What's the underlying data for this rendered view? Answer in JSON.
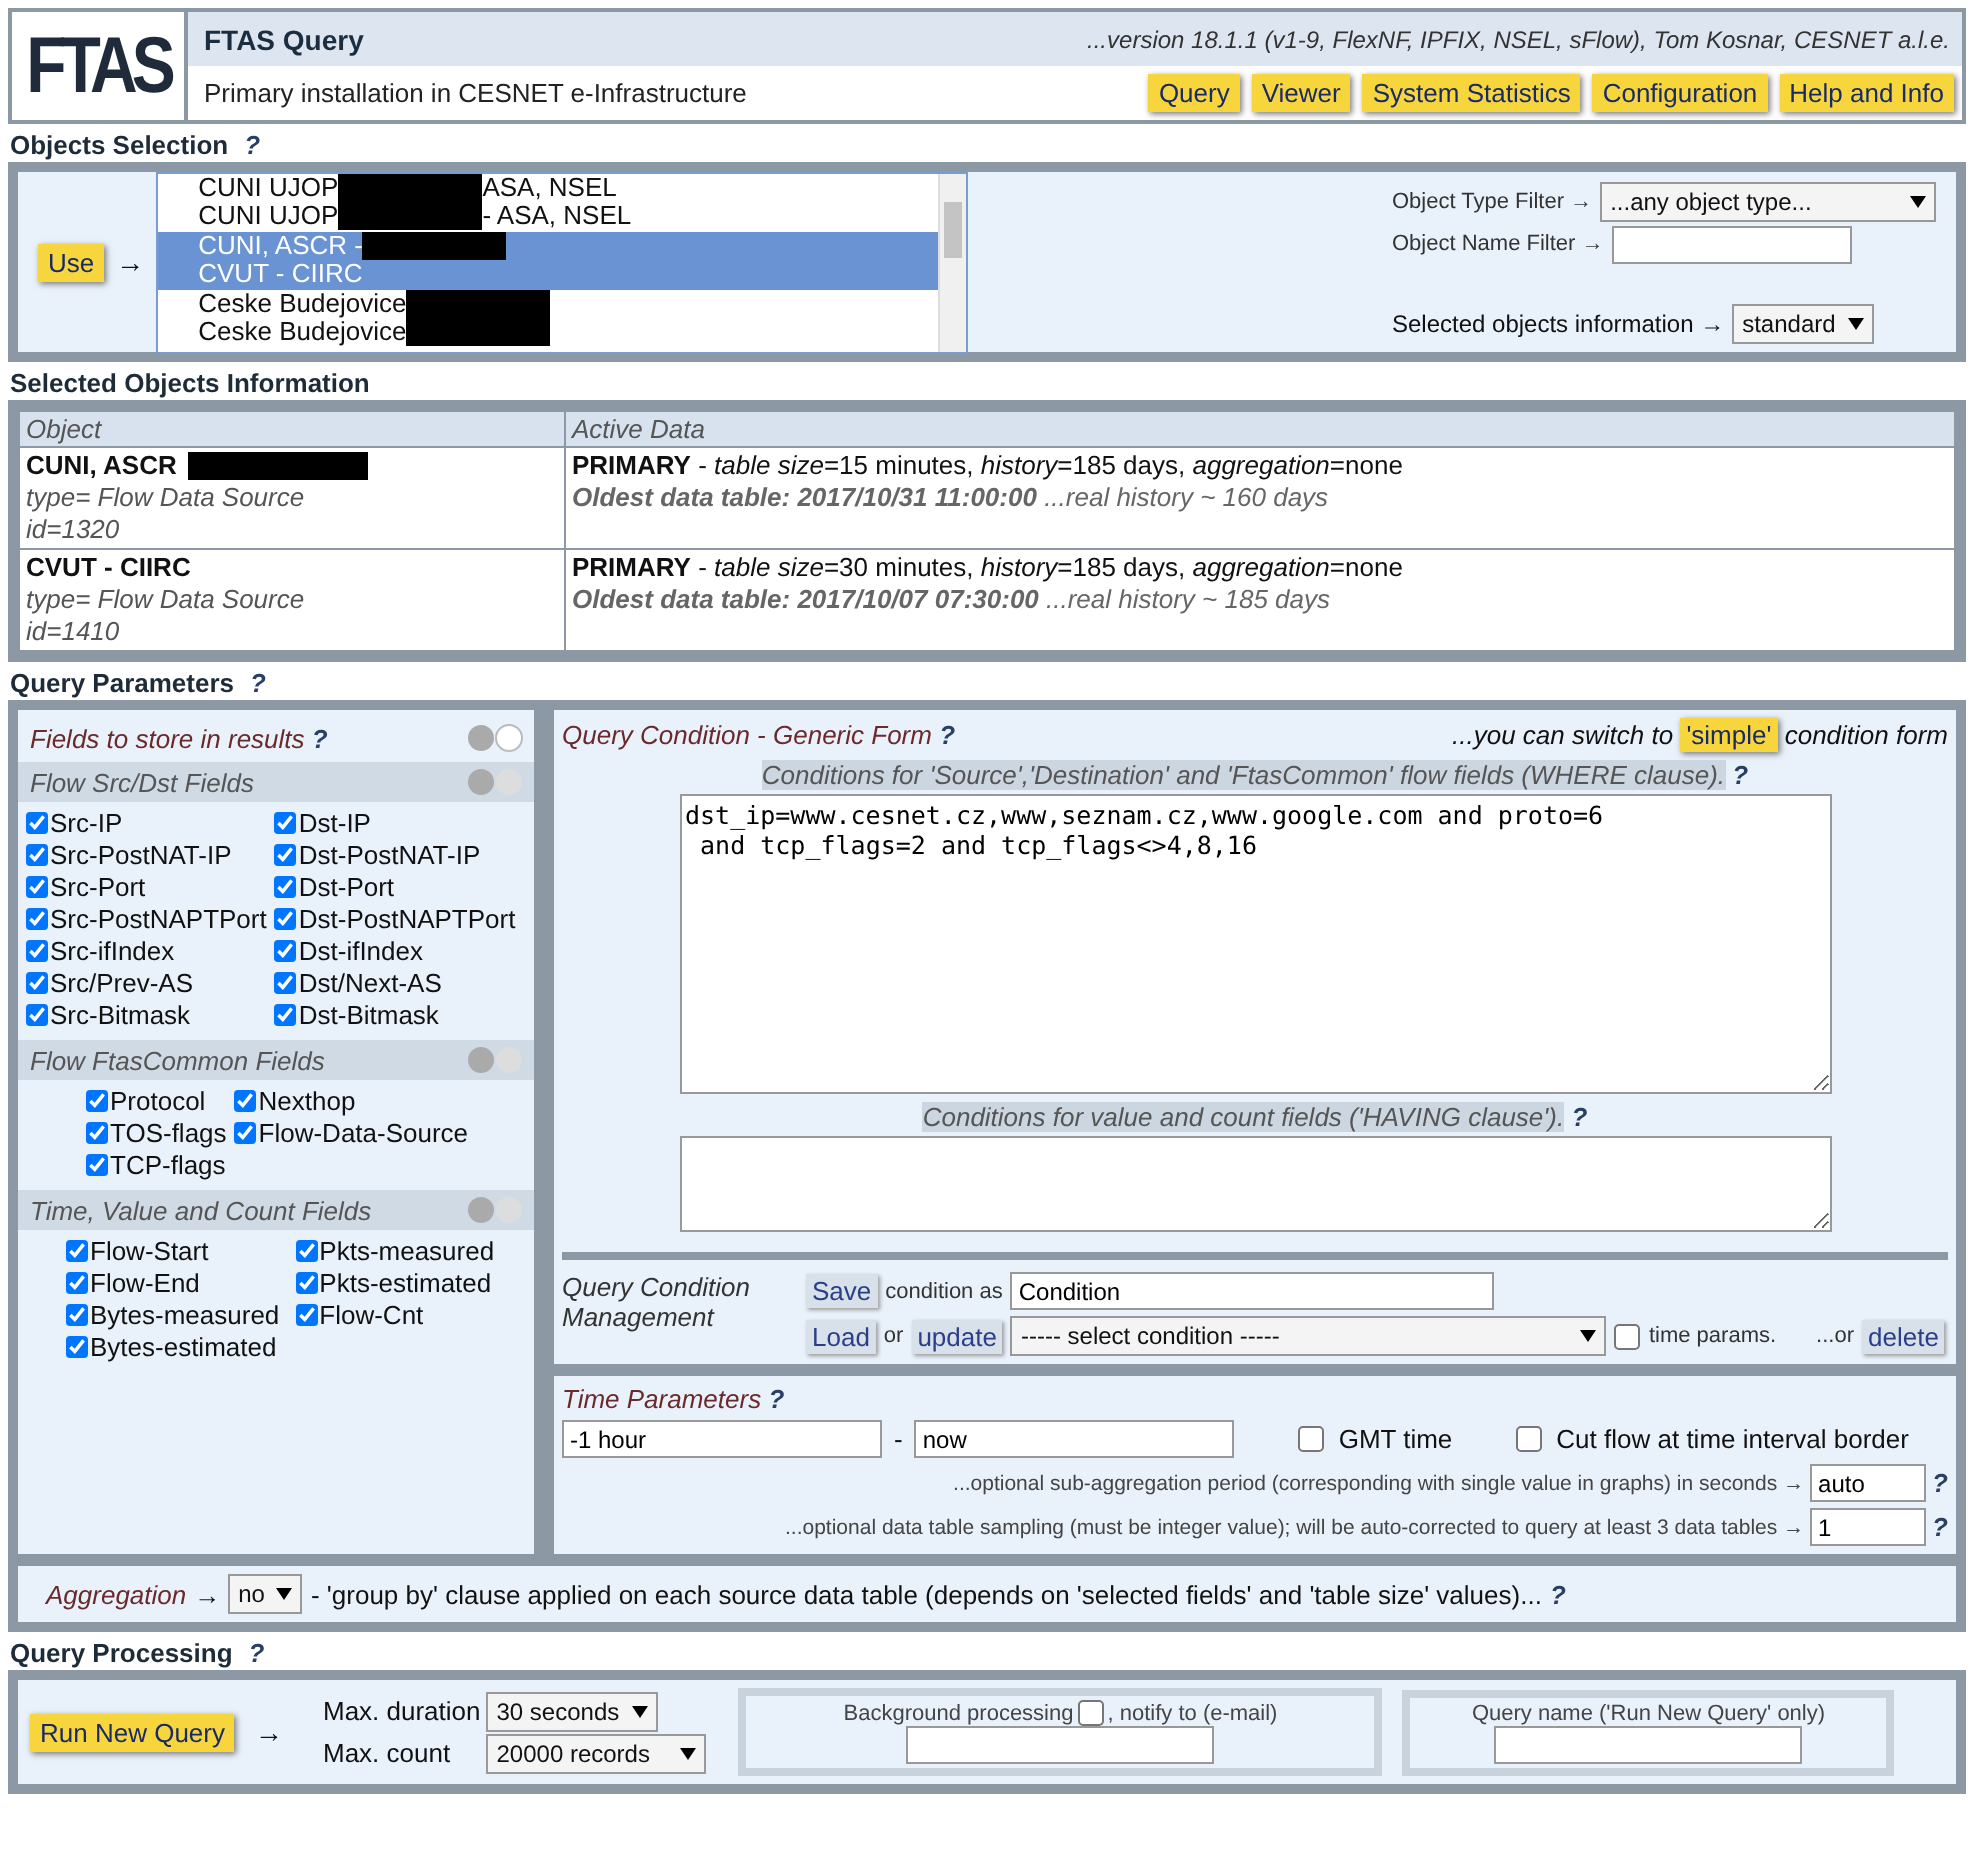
{
  "header": {
    "logo": "FTAS",
    "title": "FTAS Query",
    "version": "...version 18.1.1 (v1-9, FlexNF, IPFIX, NSEL, sFlow), Tom Kosnar, CESNET a.l.e.",
    "subtitle": "Primary installation in CESNET e-Infrastructure",
    "nav": [
      "Query",
      "Viewer",
      "System Statistics",
      "Configuration",
      "Help and Info"
    ]
  },
  "objects_selection": {
    "heading": "Objects Selection",
    "help": "?",
    "use_button": "Use",
    "arrow": "→",
    "list": [
      {
        "text": "CUNI UJOP",
        "redacted": true,
        "after": "ASA, NSEL",
        "selected": false
      },
      {
        "text": "CUNI UJOP",
        "redacted": true,
        "after": "- ASA, NSEL",
        "selected": false
      },
      {
        "text": "CUNI, ASCR -",
        "redacted": true,
        "selected": true
      },
      {
        "text": "CVUT - CIIRC",
        "redacted": false,
        "selected": true
      },
      {
        "text": "Ceske Budejovice",
        "redacted": true,
        "selected": false
      },
      {
        "text": "Ceske Budejovice",
        "redacted": true,
        "selected": false
      }
    ],
    "type_filter_label": "Object Type Filter →",
    "type_filter_value": "...any object type...",
    "name_filter_label": "Object Name Filter →",
    "info_label": "Selected objects information →",
    "info_value": "standard"
  },
  "selected_objects": {
    "heading": "Selected Objects Information",
    "columns": [
      "Object",
      "Active Data"
    ],
    "rows": [
      {
        "name": "CUNI, ASCR",
        "redacted": true,
        "type": "type= Flow Data Source",
        "id": "id=1320",
        "active": "**PRIMARY** -  *table size*=15 minutes, *history*=185 days, *aggregation*=none",
        "oldest": "**Oldest data table: 2017/10/31 11:00:00** ...real history ~ 160 days"
      },
      {
        "name": "CVUT - CIIRC",
        "redacted": false,
        "type": "type= Flow Data Source",
        "id": "id=1410",
        "active": "**PRIMARY** -  *table size*=30 minutes, *history*=185 days, *aggregation*=none",
        "oldest": "**Oldest data table: 2017/10/07 07:30:00** ...real history ~ 185 days"
      }
    ]
  },
  "query_parameters": {
    "heading": "Query Parameters",
    "help": "?",
    "fields": {
      "title": "Fields to store in results",
      "help": "?",
      "groups": [
        {
          "title": "Flow Src/Dst Fields",
          "fields": [
            {
              "label": "Src-IP",
              "checked": true
            },
            {
              "label": "Dst-IP",
              "checked": true
            },
            {
              "label": "Src-PostNAT-IP",
              "checked": true
            },
            {
              "label": "Dst-PostNAT-IP",
              "checked": true
            },
            {
              "label": "Src-Port",
              "checked": true
            },
            {
              "label": "Dst-Port",
              "checked": true
            },
            {
              "label": "Src-PostNAPTPort",
              "checked": true
            },
            {
              "label": "Dst-PostNAPTPort",
              "checked": true
            },
            {
              "label": "Src-ifIndex",
              "checked": true
            },
            {
              "label": "Dst-ifIndex",
              "checked": true
            },
            {
              "label": "Src/Prev-AS",
              "checked": true
            },
            {
              "label": "Dst/Next-AS",
              "checked": true
            },
            {
              "label": "Src-Bitmask",
              "checked": true
            },
            {
              "label": "Dst-Bitmask",
              "checked": true
            }
          ]
        },
        {
          "title": "Flow FtasCommon Fields",
          "fields": [
            {
              "label": "Protocol",
              "checked": true
            },
            {
              "label": "Nexthop",
              "checked": true
            },
            {
              "label": "TOS-flags",
              "checked": true
            },
            {
              "label": "Flow-Data-Source",
              "checked": true
            },
            {
              "label": "TCP-flags",
              "checked": true
            }
          ]
        },
        {
          "title": "Time, Value and Count Fields",
          "fields": [
            {
              "label": "Flow-Start",
              "checked": true
            },
            {
              "label": "Pkts-measured",
              "checked": true
            },
            {
              "label": "Flow-End",
              "checked": true
            },
            {
              "label": "Pkts-estimated",
              "checked": true
            },
            {
              "label": "Bytes-measured",
              "checked": true
            },
            {
              "label": "Flow-Cnt",
              "checked": true
            },
            {
              "label": "Bytes-estimated",
              "checked": true
            }
          ]
        }
      ]
    },
    "condition": {
      "title": "Query Condition - Generic Form",
      "help": "?",
      "switch_text": "...you can switch to",
      "simple_button": "'simple'",
      "switch_after": "condition form",
      "where_label": "Conditions for 'Source','Destination' and 'FtasCommon' flow fields (WHERE clause).",
      "where_help": "?",
      "where_value": "dst_ip=www.cesnet.cz,www,seznam.cz,www.google.com and proto=6\n and tcp_flags=2 and tcp_flags<>4,8,16",
      "having_label": "Conditions for value and count fields ('HAVING clause').",
      "having_help": "?"
    },
    "management": {
      "label": "Query Condition Management",
      "save": "Save",
      "condition_as": "condition as",
      "name_value": "Condition",
      "load": "Load",
      "or": "or",
      "update": "update",
      "select_value": "----- select condition -----",
      "time_params": {
        "label": "time params.",
        "checked": false
      },
      "or_text": "...or",
      "delete": "delete"
    },
    "time": {
      "title": "Time Parameters",
      "help": "?",
      "from": "-1 hour",
      "dash": "-",
      "to": "now",
      "gmt": {
        "label": "GMT time",
        "checked": false
      },
      "cut": {
        "label": "Cut flow at time interval border",
        "checked": false
      },
      "subagg_label": "...optional sub-aggregation period (corresponding with single value in graphs) in seconds →",
      "subagg_value": "auto",
      "subagg_help": "?",
      "sampling_label": "...optional data table sampling (must be integer value); will be auto-corrected to query at least 3 data tables →",
      "sampling_value": "1",
      "sampling_help": "?"
    },
    "aggregation": {
      "label": "Aggregation",
      "arrow": "→",
      "value": "no",
      "text": "- 'group by' clause applied on each source data table (depends on 'selected fields' and 'table size' values)...",
      "help": "?"
    }
  },
  "query_processing": {
    "heading": "Query Processing",
    "help": "?",
    "run_button": "Run New Query",
    "arrow": "→",
    "duration_label": "Max. duration",
    "duration_value": "30 seconds",
    "count_label": "Max. count",
    "count_value": "20000 records",
    "background_label": "Background processing",
    "background_checked": false,
    "notify_label": ", notify to (e-mail)",
    "query_name_label": "Query name ('Run New Query' only)"
  }
}
